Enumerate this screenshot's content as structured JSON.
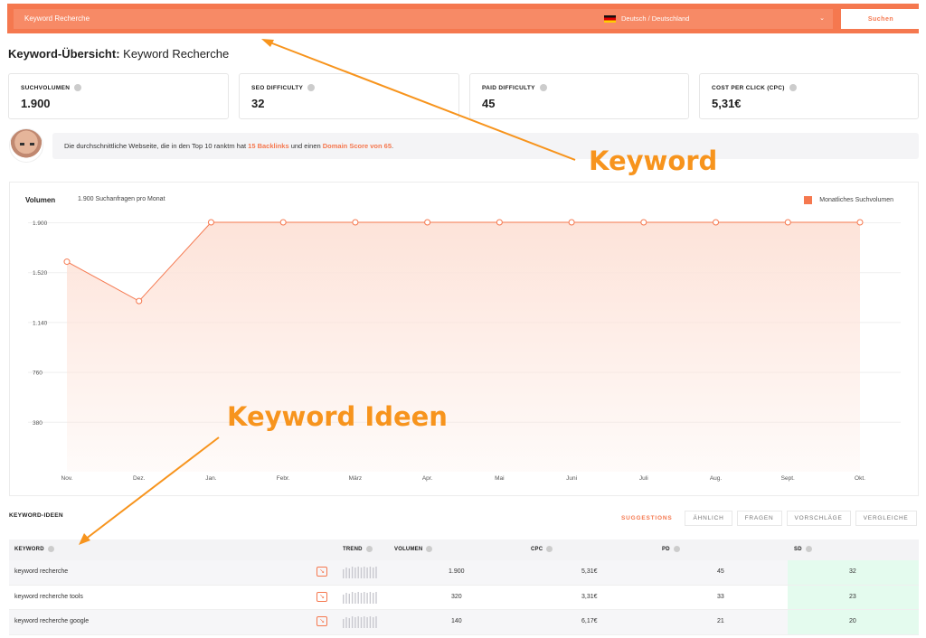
{
  "search": {
    "value": "Keyword Recherche",
    "button_label": "Suchen"
  },
  "language": {
    "selected": "Deutsch / Deutschland",
    "flag_icon": "flag-de-icon"
  },
  "page_title": {
    "prefix": "Keyword-Übersicht:",
    "keyword": "Keyword Recherche"
  },
  "metrics": [
    {
      "label": "SUCHVOLUMEN",
      "value": "1.900"
    },
    {
      "label": "SEO DIFFICULTY",
      "value": "32"
    },
    {
      "label": "PAID DIFFICULTY",
      "value": "45"
    },
    {
      "label": "COST PER CLICK (CPC)",
      "value": "5,31€"
    }
  ],
  "tip": {
    "text_before": "Die durchschnittliche Webseite, die in den Top 10 ranktm hat ",
    "backlinks": "15 Backlinks",
    "text_middle": " und einen ",
    "domain_score": "Domain Score von 65",
    "text_after": "."
  },
  "chart_card": {
    "title": "Volumen",
    "subtitle": "1.900 Suchanfragen pro Monat",
    "legend": "Monatliches Suchvolumen"
  },
  "chart_data": {
    "type": "area",
    "categories": [
      "Nov.",
      "Dez.",
      "Jan.",
      "Febr.",
      "März",
      "Apr.",
      "Mai",
      "Juni",
      "Juli",
      "Aug.",
      "Sept.",
      "Okt."
    ],
    "series": [
      {
        "name": "Monatliches Suchvolumen",
        "values": [
          1600,
          1300,
          1900,
          1900,
          1900,
          1900,
          1900,
          1900,
          1900,
          1900,
          1900,
          1900
        ]
      }
    ],
    "y_ticks": [
      "1.900",
      "1.520",
      "1.140",
      "760",
      "380"
    ],
    "y_tick_values": [
      1900,
      1520,
      1140,
      760,
      380
    ],
    "ylim": [
      0,
      1900
    ],
    "grid": true,
    "legend_position": "top-right",
    "colors": {
      "line": "#f5784f",
      "fill": "#fde3d9"
    }
  },
  "annotations": {
    "keyword": "Keyword",
    "keyword_ideas": "Keyword Ideen",
    "color": "#f7941d"
  },
  "ideas": {
    "title": "KEYWORD-IDEEN",
    "tabs": [
      "SUGGESTIONS",
      "ÄHNLICH",
      "FRAGEN",
      "VORSCHLÄGE",
      "VERGLEICHE"
    ],
    "headers": {
      "keyword": "KEYWORD",
      "trend": "TREND",
      "volume": "VOLUMEN",
      "cpc": "CPC",
      "pd": "PD",
      "sd": "SD"
    },
    "rows": [
      {
        "keyword": "keyword recherche",
        "volume": "1.900",
        "cpc": "5,31€",
        "pd": "45",
        "sd": "32"
      },
      {
        "keyword": "keyword recherche tools",
        "volume": "320",
        "cpc": "3,31€",
        "pd": "33",
        "sd": "23"
      },
      {
        "keyword": "keyword recherche google",
        "volume": "140",
        "cpc": "6,17€",
        "pd": "21",
        "sd": "20"
      }
    ]
  }
}
